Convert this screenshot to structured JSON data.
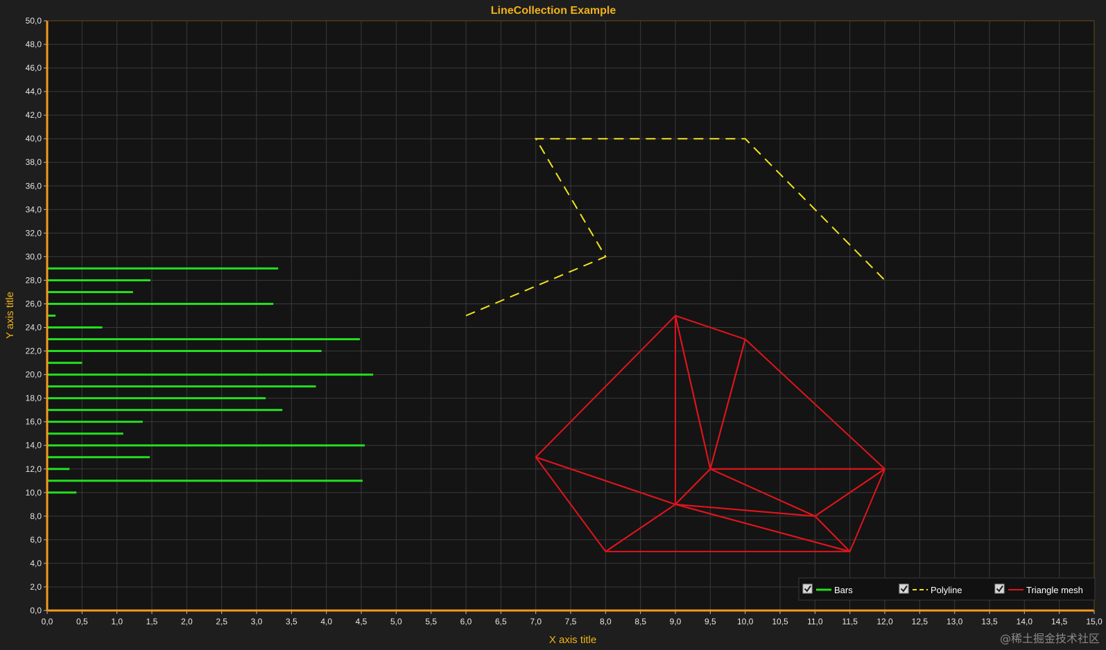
{
  "watermark": "@稀土掘金技术社区",
  "chart_data": {
    "type": "line",
    "title": "LineCollection Example",
    "xlabel": "X axis title",
    "ylabel": "Y axis title",
    "xlim": [
      0,
      15
    ],
    "ylim": [
      0,
      50
    ],
    "x_ticks": [
      "0,0",
      "0,5",
      "1,0",
      "1,5",
      "2,0",
      "2,5",
      "3,0",
      "3,5",
      "4,0",
      "4,5",
      "5,0",
      "5,5",
      "6,0",
      "6,5",
      "7,0",
      "7,5",
      "8,0",
      "8,5",
      "9,0",
      "9,5",
      "10,0",
      "10,5",
      "11,0",
      "11,5",
      "12,0",
      "12,5",
      "13,0",
      "13,5",
      "14,0",
      "14,5",
      "15,0"
    ],
    "y_ticks": [
      "0,0",
      "2,0",
      "4,0",
      "6,0",
      "8,0",
      "10,0",
      "12,0",
      "14,0",
      "16,0",
      "18,0",
      "20,0",
      "22,0",
      "24,0",
      "26,0",
      "28,0",
      "30,0",
      "32,0",
      "34,0",
      "36,0",
      "38,0",
      "40,0",
      "42,0",
      "44,0",
      "46,0",
      "48,0",
      "50,0"
    ],
    "grid": true,
    "legend_position": "bottom-right",
    "colors": {
      "background": "#1e1e1e",
      "plot_background": "#141414",
      "grid": "#3a3a3a",
      "axis": "#f59a1c",
      "title": "#f2b21a",
      "bars": "#22e01e",
      "polyline": "#f2e61a",
      "mesh": "#e0141c"
    },
    "series": [
      {
        "name": "Bars",
        "style": "solid",
        "segments": [
          [
            [
              0,
              10
            ],
            [
              0.42,
              10
            ]
          ],
          [
            [
              0,
              11
            ],
            [
              4.52,
              11
            ]
          ],
          [
            [
              0,
              12
            ],
            [
              0.32,
              12
            ]
          ],
          [
            [
              0,
              13
            ],
            [
              1.47,
              13
            ]
          ],
          [
            [
              0,
              14
            ],
            [
              4.55,
              14
            ]
          ],
          [
            [
              0,
              15
            ],
            [
              1.09,
              15
            ]
          ],
          [
            [
              0,
              16
            ],
            [
              1.37,
              16
            ]
          ],
          [
            [
              0,
              17
            ],
            [
              3.37,
              17
            ]
          ],
          [
            [
              0,
              18
            ],
            [
              3.13,
              18
            ]
          ],
          [
            [
              0,
              19
            ],
            [
              3.85,
              19
            ]
          ],
          [
            [
              0,
              20
            ],
            [
              4.67,
              20
            ]
          ],
          [
            [
              0,
              21
            ],
            [
              0.5,
              21
            ]
          ],
          [
            [
              0,
              22
            ],
            [
              3.93,
              22
            ]
          ],
          [
            [
              0,
              23
            ],
            [
              4.48,
              23
            ]
          ],
          [
            [
              0,
              24
            ],
            [
              0.79,
              24
            ]
          ],
          [
            [
              0,
              25
            ],
            [
              0.12,
              25
            ]
          ],
          [
            [
              0,
              26
            ],
            [
              3.24,
              26
            ]
          ],
          [
            [
              0,
              27
            ],
            [
              1.23,
              27
            ]
          ],
          [
            [
              0,
              28
            ],
            [
              1.48,
              28
            ]
          ],
          [
            [
              0,
              29
            ],
            [
              3.31,
              29
            ]
          ]
        ]
      },
      {
        "name": "Polyline",
        "style": "dashed",
        "points": [
          [
            6,
            25
          ],
          [
            8,
            30
          ],
          [
            7,
            40
          ],
          [
            10,
            40
          ],
          [
            12,
            28
          ]
        ]
      },
      {
        "name": "Triangle mesh",
        "style": "solid",
        "triangles": [
          [
            [
              7,
              13
            ],
            [
              9,
              25
            ],
            [
              9,
              9
            ]
          ],
          [
            [
              9,
              25
            ],
            [
              9.5,
              12
            ],
            [
              9,
              9
            ]
          ],
          [
            [
              9,
              25
            ],
            [
              10,
              23
            ],
            [
              9.5,
              12
            ]
          ],
          [
            [
              10,
              23
            ],
            [
              12,
              12
            ],
            [
              9.5,
              12
            ]
          ],
          [
            [
              7,
              13
            ],
            [
              9,
              9
            ],
            [
              8,
              5
            ]
          ],
          [
            [
              8,
              5
            ],
            [
              9,
              9
            ],
            [
              11.5,
              5
            ]
          ],
          [
            [
              9,
              9
            ],
            [
              11,
              8
            ],
            [
              11.5,
              5
            ]
          ],
          [
            [
              9,
              9
            ],
            [
              9.5,
              12
            ],
            [
              11,
              8
            ]
          ],
          [
            [
              9.5,
              12
            ],
            [
              12,
              12
            ],
            [
              11,
              8
            ]
          ],
          [
            [
              11,
              8
            ],
            [
              12,
              12
            ],
            [
              11.5,
              5
            ]
          ]
        ]
      }
    ]
  }
}
